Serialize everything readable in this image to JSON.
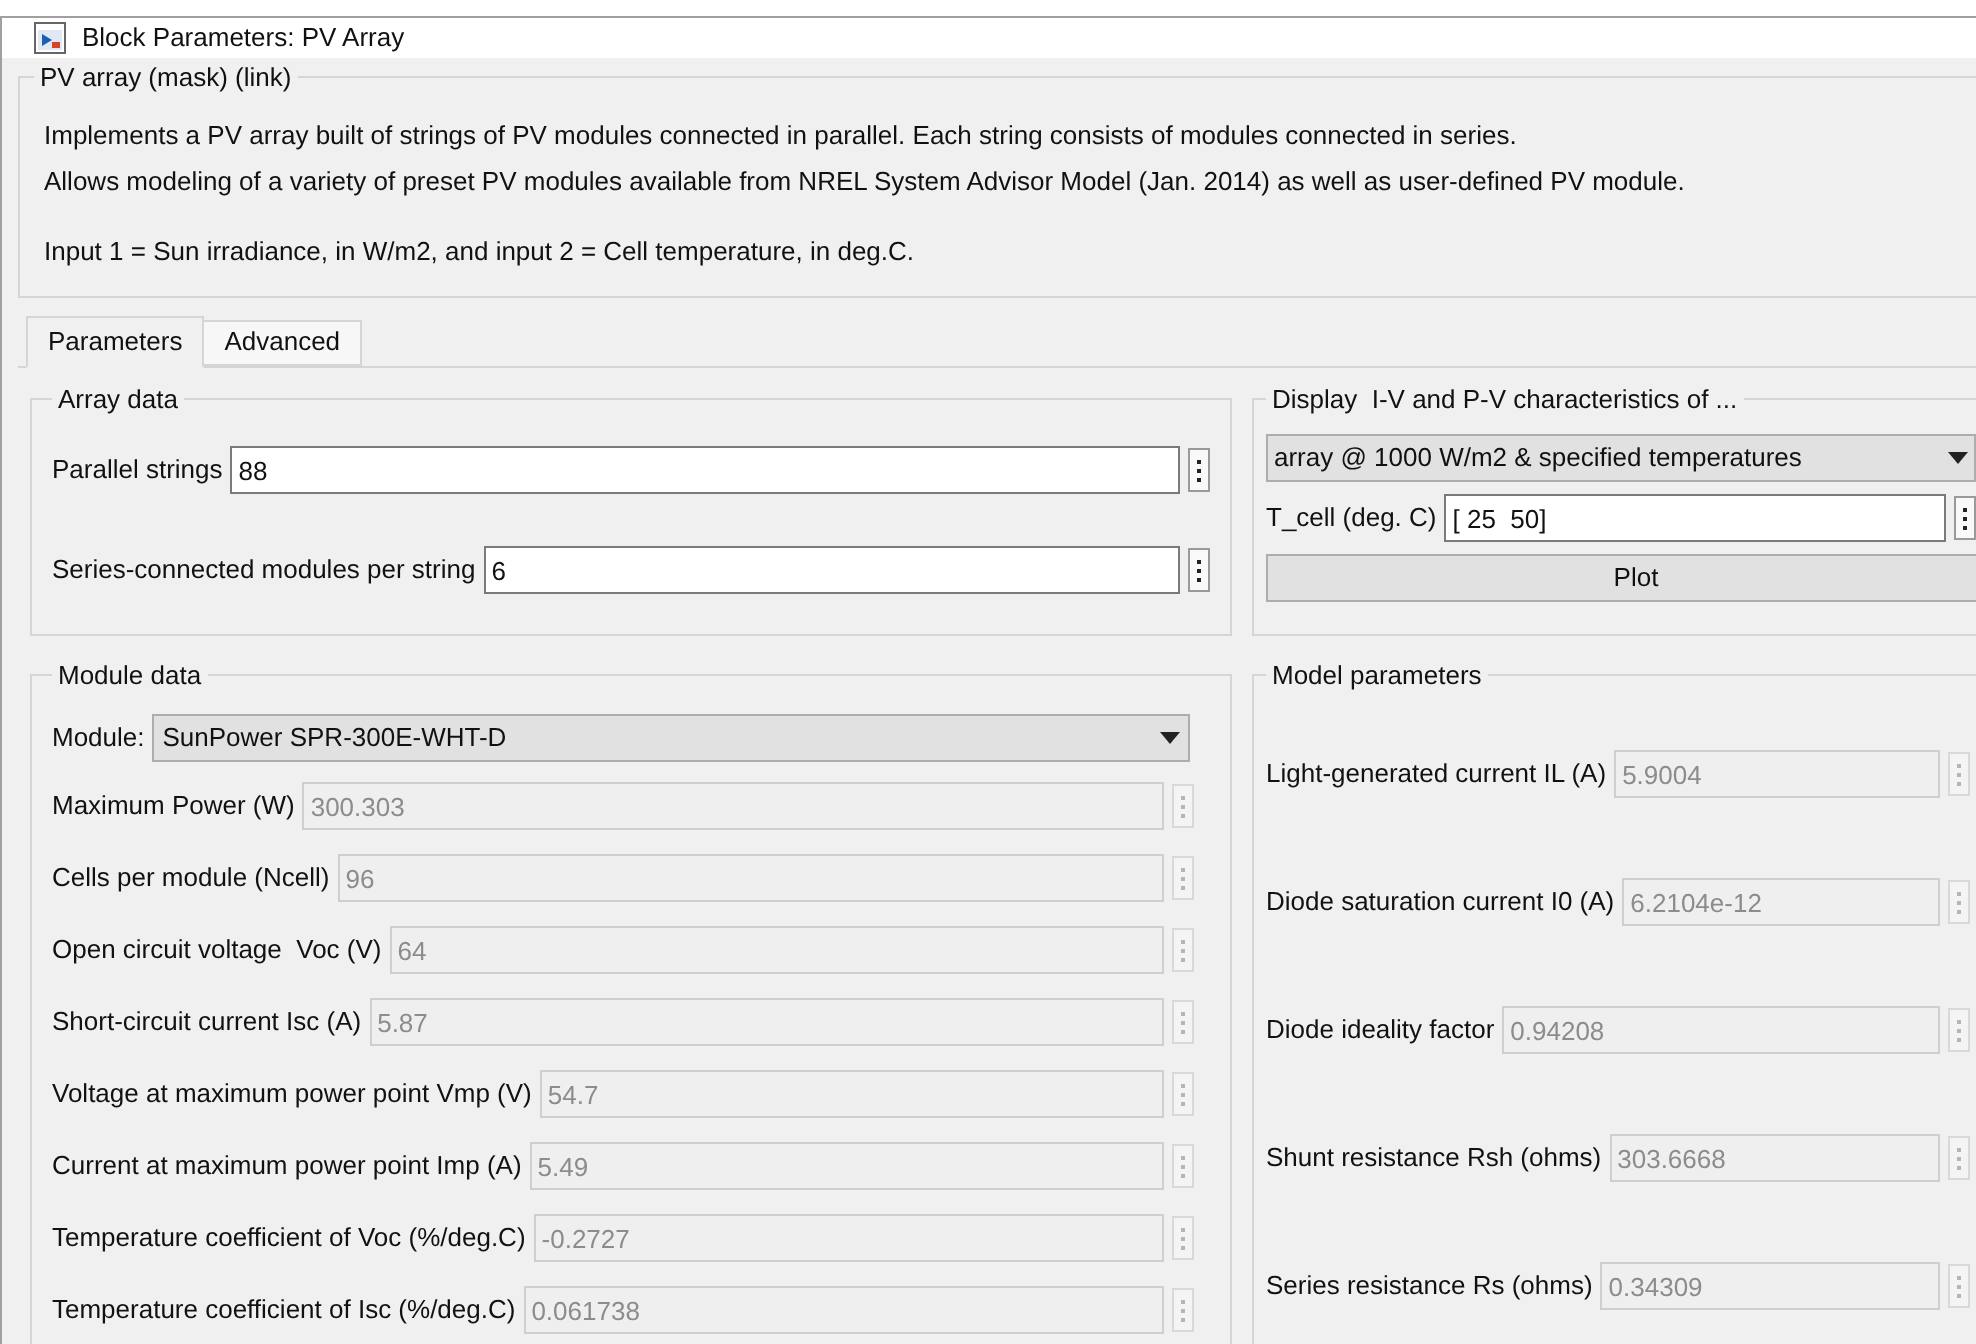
{
  "window": {
    "title": "Block Parameters: PV Array"
  },
  "description": {
    "title": "PV array (mask) (link)",
    "paragraphs": [
      [
        "Implements a PV array built of strings of PV modules connected in parallel. Each string consists of modules connected in series.",
        "Allows modeling of a variety of preset PV modules available from NREL System Advisor Model (Jan. 2014) as well as user-defined PV module."
      ],
      [
        "Input 1 = Sun irradiance, in W/m2, and input 2 = Cell temperature, in deg.C."
      ]
    ]
  },
  "tabs": [
    {
      "label": "Parameters",
      "selected": true
    },
    {
      "label": "Advanced",
      "selected": false
    }
  ],
  "array_data": {
    "title": "Array data",
    "fields": [
      {
        "label": "Parallel strings",
        "value": "88",
        "disabled": false
      },
      {
        "label": "Series-connected modules per string",
        "value": "6",
        "disabled": false
      }
    ]
  },
  "display": {
    "title": "Display  I-V and P-V characteristics of ...",
    "dropdown": {
      "value": "array @ 1000 W/m2 & specified temperatures"
    },
    "t_cell": {
      "label": "T_cell (deg. C)",
      "value": "[ 25  50]",
      "disabled": false
    },
    "plot_button": "Plot"
  },
  "module_data": {
    "title": "Module data",
    "module": {
      "label": "Module:",
      "value": "SunPower SPR-300E-WHT-D"
    },
    "fields": [
      {
        "label": "Maximum Power (W)",
        "value": "300.303",
        "disabled": true
      },
      {
        "label": "Cells per module (Ncell)",
        "value": "96",
        "disabled": true
      },
      {
        "label": "Open circuit voltage  Voc (V)",
        "value": "64",
        "disabled": true
      },
      {
        "label": "Short-circuit current Isc (A)",
        "value": "5.87",
        "disabled": true
      },
      {
        "label": "Voltage at maximum power point Vmp (V)",
        "value": "54.7",
        "disabled": true
      },
      {
        "label": "Current at maximum power point Imp (A)",
        "value": "5.49",
        "disabled": true
      },
      {
        "label": "Temperature coefficient of Voc (%/deg.C)",
        "value": "-0.2727",
        "disabled": true
      },
      {
        "label": "Temperature coefficient of Isc (%/deg.C)",
        "value": "0.061738",
        "disabled": true
      }
    ]
  },
  "model_parameters": {
    "title": "Model parameters",
    "fields": [
      {
        "label": "Light-generated current IL (A)",
        "value": "5.9004",
        "disabled": true
      },
      {
        "label": "Diode saturation current I0 (A)",
        "value": "6.2104e-12",
        "disabled": true
      },
      {
        "label": "Diode ideality factor",
        "value": "0.94208",
        "disabled": true
      },
      {
        "label": "Shunt resistance Rsh (ohms)",
        "value": "303.6668",
        "disabled": true
      },
      {
        "label": "Series resistance Rs (ohms)",
        "value": "0.34309",
        "disabled": true
      }
    ]
  }
}
